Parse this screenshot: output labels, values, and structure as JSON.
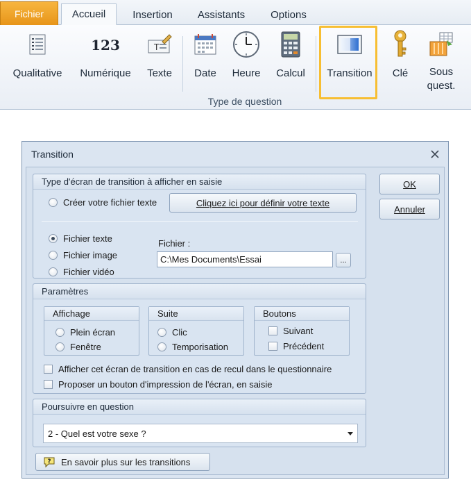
{
  "ribbon": {
    "tabs": [
      "Fichier",
      "Accueil",
      "Insertion",
      "Assistants",
      "Options"
    ],
    "active_tab": "Accueil",
    "buttons": [
      {
        "label": "Qualitative",
        "icon": "list-icon"
      },
      {
        "label": "Numérique",
        "icon": "number-123-icon"
      },
      {
        "label": "Texte",
        "icon": "text-pencil-icon"
      },
      {
        "label": "Date",
        "icon": "calendar-icon"
      },
      {
        "label": "Heure",
        "icon": "clock-icon"
      },
      {
        "label": "Calcul",
        "icon": "calculator-icon"
      },
      {
        "label": "Transition",
        "icon": "transition-screen-icon"
      },
      {
        "label": "Clé",
        "icon": "key-icon"
      },
      {
        "label": "Sous\nquest.",
        "icon": "sub-question-icon"
      }
    ],
    "group_label": "Type de question",
    "highlight_color": "#f7be32",
    "accent_color": "#e7951a"
  },
  "dialog": {
    "title": "Transition",
    "ok_label": "OK",
    "cancel_label": "Annuler",
    "type_group": {
      "title": "Type d'écran de transition à afficher en saisie",
      "create_text_option": "Créer votre fichier texte",
      "define_text_button": "Cliquez ici pour définir votre texte",
      "options": [
        "Fichier texte",
        "Fichier image",
        "Fichier vidéo"
      ],
      "selected_option": "Fichier texte",
      "file_label": "Fichier :",
      "file_value": "C:\\Mes Documents\\Essai",
      "browse_label": "..."
    },
    "params_group": {
      "title": "Paramètres",
      "affichage": {
        "title": "Affichage",
        "options": [
          "Plein écran",
          "Fenêtre"
        ]
      },
      "suite": {
        "title": "Suite",
        "options": [
          "Clic",
          "Temporisation"
        ]
      },
      "boutons": {
        "title": "Boutons",
        "options": [
          "Suivant",
          "Précédent"
        ]
      },
      "check_recul": "Afficher cet écran de transition en cas de recul dans le questionnaire",
      "check_impression": "Proposer un bouton d'impression de l'écran, en saisie"
    },
    "continue_group": {
      "title": "Poursuivre en question",
      "selected_value": "2 - Quel est votre sexe ?"
    },
    "help_button": "En savoir plus sur les transitions"
  }
}
